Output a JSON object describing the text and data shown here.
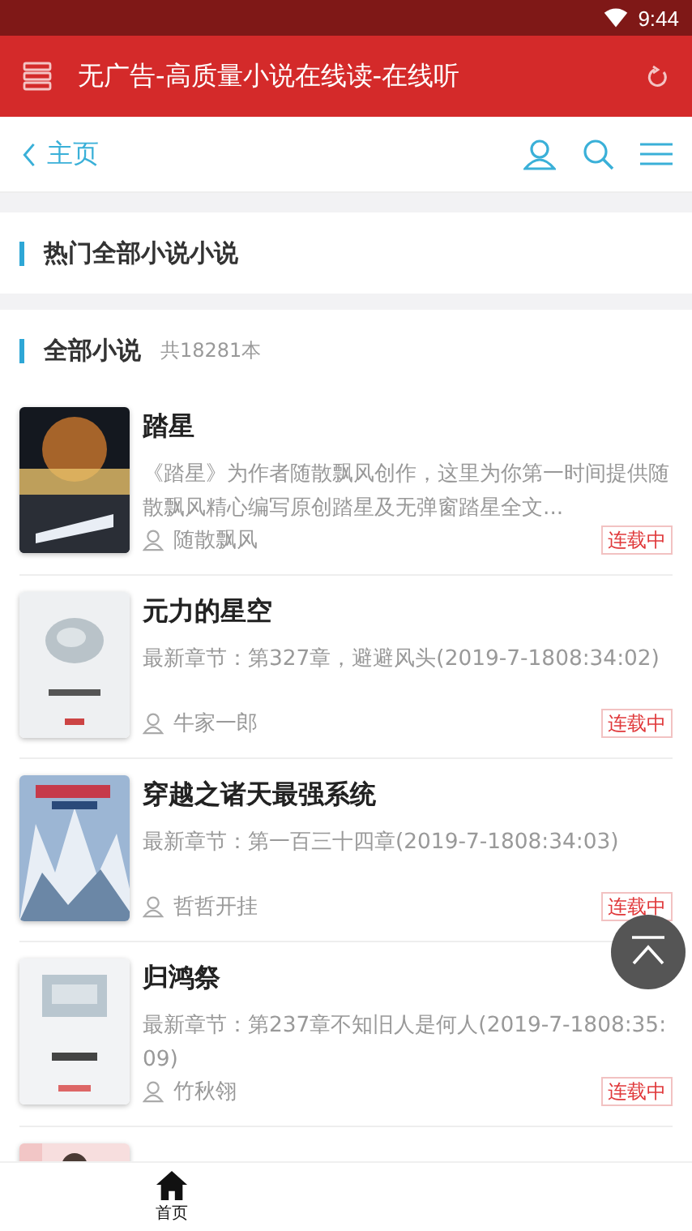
{
  "status_bar": {
    "time": "9:44"
  },
  "app_bar": {
    "title": "无广告-高质量小说在线读-在线听"
  },
  "nav": {
    "back_label": "主页"
  },
  "sections": [
    {
      "title": "热门全部小说小说"
    },
    {
      "title": "全部小说",
      "count": "共18281本"
    }
  ],
  "books": [
    {
      "title": "踏星",
      "summary": "《踏星》为作者随散飘风创作，这里为你第一时间提供随散飘风精心编写原创踏星及无弹窗踏星全文...",
      "author": "随散飘风",
      "status": "连载中"
    },
    {
      "title": "元力的星空",
      "summary": "最新章节：第327章，避避风头(2019-7-1808:34:02)",
      "author": "牛家一郎",
      "status": "连载中"
    },
    {
      "title": "穿越之诸天最强系统",
      "summary": "最新章节：第一百三十四章(2019-7-1808:34:03)",
      "author": "哲哲开挂",
      "status": "连载中"
    },
    {
      "title": "归鸿祭",
      "summary": "最新章节：第237章不知旧人是何人(2019-7-1808:35:09)",
      "author": "竹秋翎",
      "status": "连载中"
    },
    {
      "kind": "picture"
    }
  ],
  "tab_bar": [
    {
      "label": "首页",
      "selected": true
    }
  ]
}
